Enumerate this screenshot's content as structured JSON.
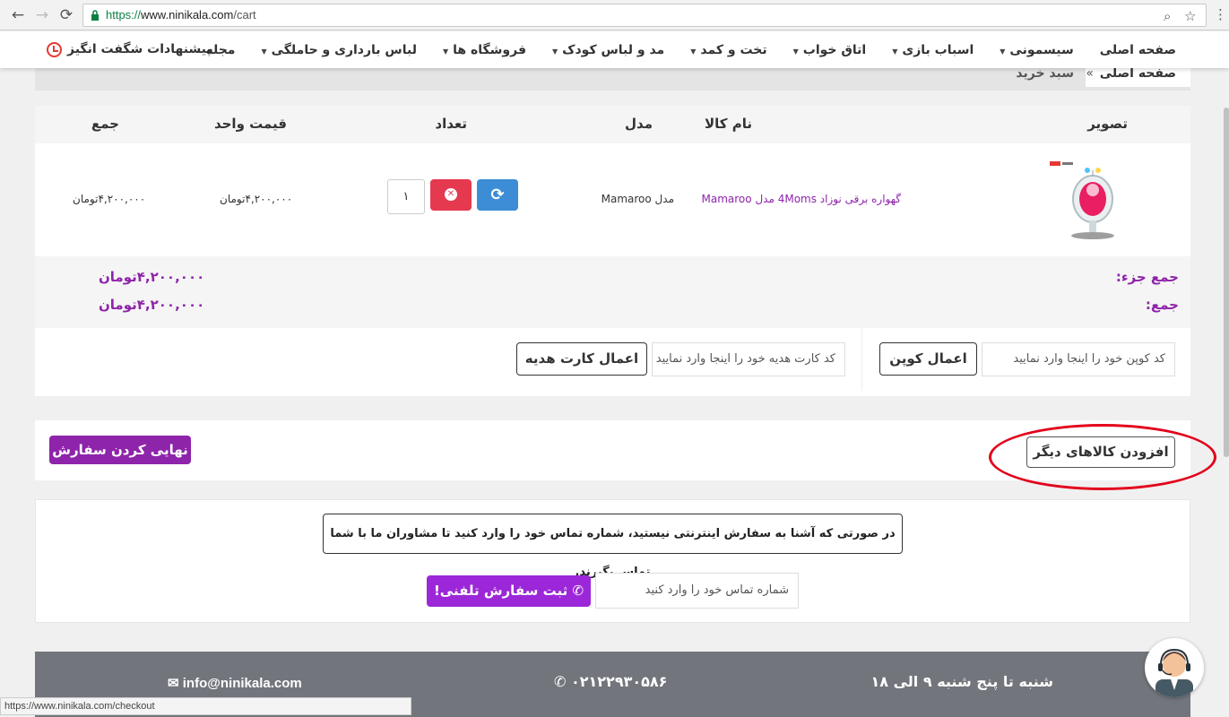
{
  "browser": {
    "url_scheme": "https://",
    "url_host": "www.ninikala.com",
    "url_path": "/cart",
    "status_url": "https://www.ninikala.com/checkout"
  },
  "menu": {
    "items": [
      {
        "label": "صفحه اصلی",
        "dropdown": false
      },
      {
        "label": "سیسمونی",
        "dropdown": true
      },
      {
        "label": "اسباب بازی",
        "dropdown": true
      },
      {
        "label": "اتاق خواب",
        "dropdown": true
      },
      {
        "label": "تخت و کمد",
        "dropdown": true
      },
      {
        "label": "مد و لباس کودک",
        "dropdown": true
      },
      {
        "label": "فروشگاه ها",
        "dropdown": true
      },
      {
        "label": "لباس بارداری و حاملگی",
        "dropdown": true
      },
      {
        "label": "مجله",
        "dropdown": false
      }
    ],
    "promo": "پیشنهادات شگفت انگیز"
  },
  "breadcrumb": {
    "home": "صفحه اصلی",
    "separator": "»",
    "current": "سبد خرید"
  },
  "cart": {
    "headers": {
      "image": "تصویر",
      "name": "نام کالا",
      "model": "مدل",
      "quantity": "تعداد",
      "unit_price": "قیمت واحد",
      "total": "جمع"
    },
    "item": {
      "name": "گهواره برقی نوزاد 4Moms مدل Mamaroo",
      "model": "مدل Mamaroo",
      "quantity": "۱",
      "unit_price": "۴,۲۰۰,۰۰۰تومان",
      "total": "۴,۲۰۰,۰۰۰تومان"
    },
    "subtotal_label": "جمع جزء:",
    "subtotal_value": "۴,۲۰۰,۰۰۰تومان",
    "total_label": "جمع:",
    "total_value": "۴,۲۰۰,۰۰۰تومان",
    "coupon_placeholder": "کد کوپن خود را اینجا وارد نمایید",
    "coupon_button": "اعمال کوپن",
    "gift_placeholder": "کد کارت هدیه خود را اینجا وارد نمایید",
    "gift_button": "اعمال کارت هدیه"
  },
  "actions": {
    "add_more": "افزودن کالاهای دیگر",
    "finalize": "نهایی کردن سفارش"
  },
  "phone_order": {
    "notice": "در صورتی که آشنا به سفارش اینترنتی نیستید، شماره تماس خود را وارد کنید تا مشاوران ما با شما تماس بگیرند.",
    "placeholder": "شماره تماس خود را وارد کنید",
    "button": "ثبت سفارش تلفنی!"
  },
  "footer": {
    "hours": "شنبه تا پنج شنبه ۹ الی ۱۸",
    "phone": "۰۲۱۲۲۹۳۰۵۸۶",
    "email": "info@ninikala.com"
  },
  "colors": {
    "brand_purple": "#8e24aa",
    "remove_red": "#e53950",
    "refresh_blue": "#3c8dd6",
    "highlight_red": "#e3001b",
    "footer_gray": "#72757c"
  }
}
